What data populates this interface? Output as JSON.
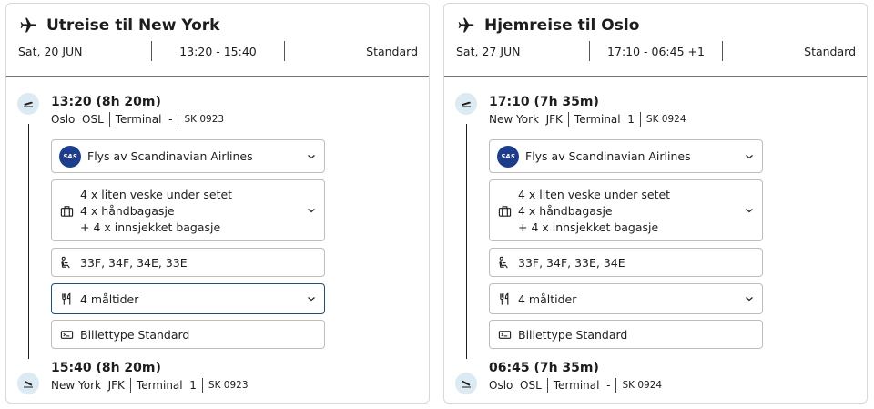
{
  "outbound": {
    "title": "Utreise til New York",
    "date": "Sat, 20 JUN",
    "times": "13:20 - 15:40",
    "fare": "Standard",
    "departure": {
      "time": "13:20  (8h 20m)",
      "city": "Oslo",
      "code": "OSL",
      "terminal_label": "Terminal",
      "terminal": "-",
      "flight": "SK 0923"
    },
    "airline": "Flys av Scandinavian Airlines",
    "baggage": [
      "4 x liten veske under setet",
      "4 x håndbagasje",
      "+ 4 x innsjekket bagasje"
    ],
    "seats": "33F, 34F, 34E, 33E",
    "meals": "4 måltider",
    "ticket": "Billettype Standard",
    "arrival": {
      "time": "15:40  (8h 20m)",
      "city": "New York",
      "code": "JFK",
      "terminal_label": "Terminal",
      "terminal": "1",
      "flight": "SK 0923"
    }
  },
  "inbound": {
    "title": "Hjemreise til Oslo",
    "date": "Sat, 27 JUN",
    "times": "17:10 - 06:45 +1",
    "fare": "Standard",
    "departure": {
      "time": "17:10  (7h 35m)",
      "city": "New York",
      "code": "JFK",
      "terminal_label": "Terminal",
      "terminal": "1",
      "flight": "SK 0924"
    },
    "airline": "Flys av Scandinavian Airlines",
    "baggage": [
      "4 x liten veske under setet",
      "4 x håndbagasje",
      "+ 4 x innsjekket bagasje"
    ],
    "seats": "33F, 34F, 33E, 34E",
    "meals": "4 måltider",
    "ticket": "Billettype Standard",
    "arrival": {
      "time": "06:45  (7h 35m)",
      "city": "Oslo",
      "code": "OSL",
      "terminal_label": "Terminal",
      "terminal": "-",
      "flight": "SK 0924"
    }
  },
  "airline_logo_text": "SAS",
  "icons": {
    "title": "airplane-icon",
    "takeoff": "takeoff-icon",
    "landing": "landing-icon",
    "baggage": "luggage-icon",
    "seat": "seat-icon",
    "meal": "cutlery-icon",
    "ticket": "ticket-icon",
    "expand": "chevron-down-icon"
  },
  "colors": {
    "node_bg": "#dbeaf3",
    "sas_blue": "#1c3c8c",
    "focus_border": "#1f4f77"
  }
}
